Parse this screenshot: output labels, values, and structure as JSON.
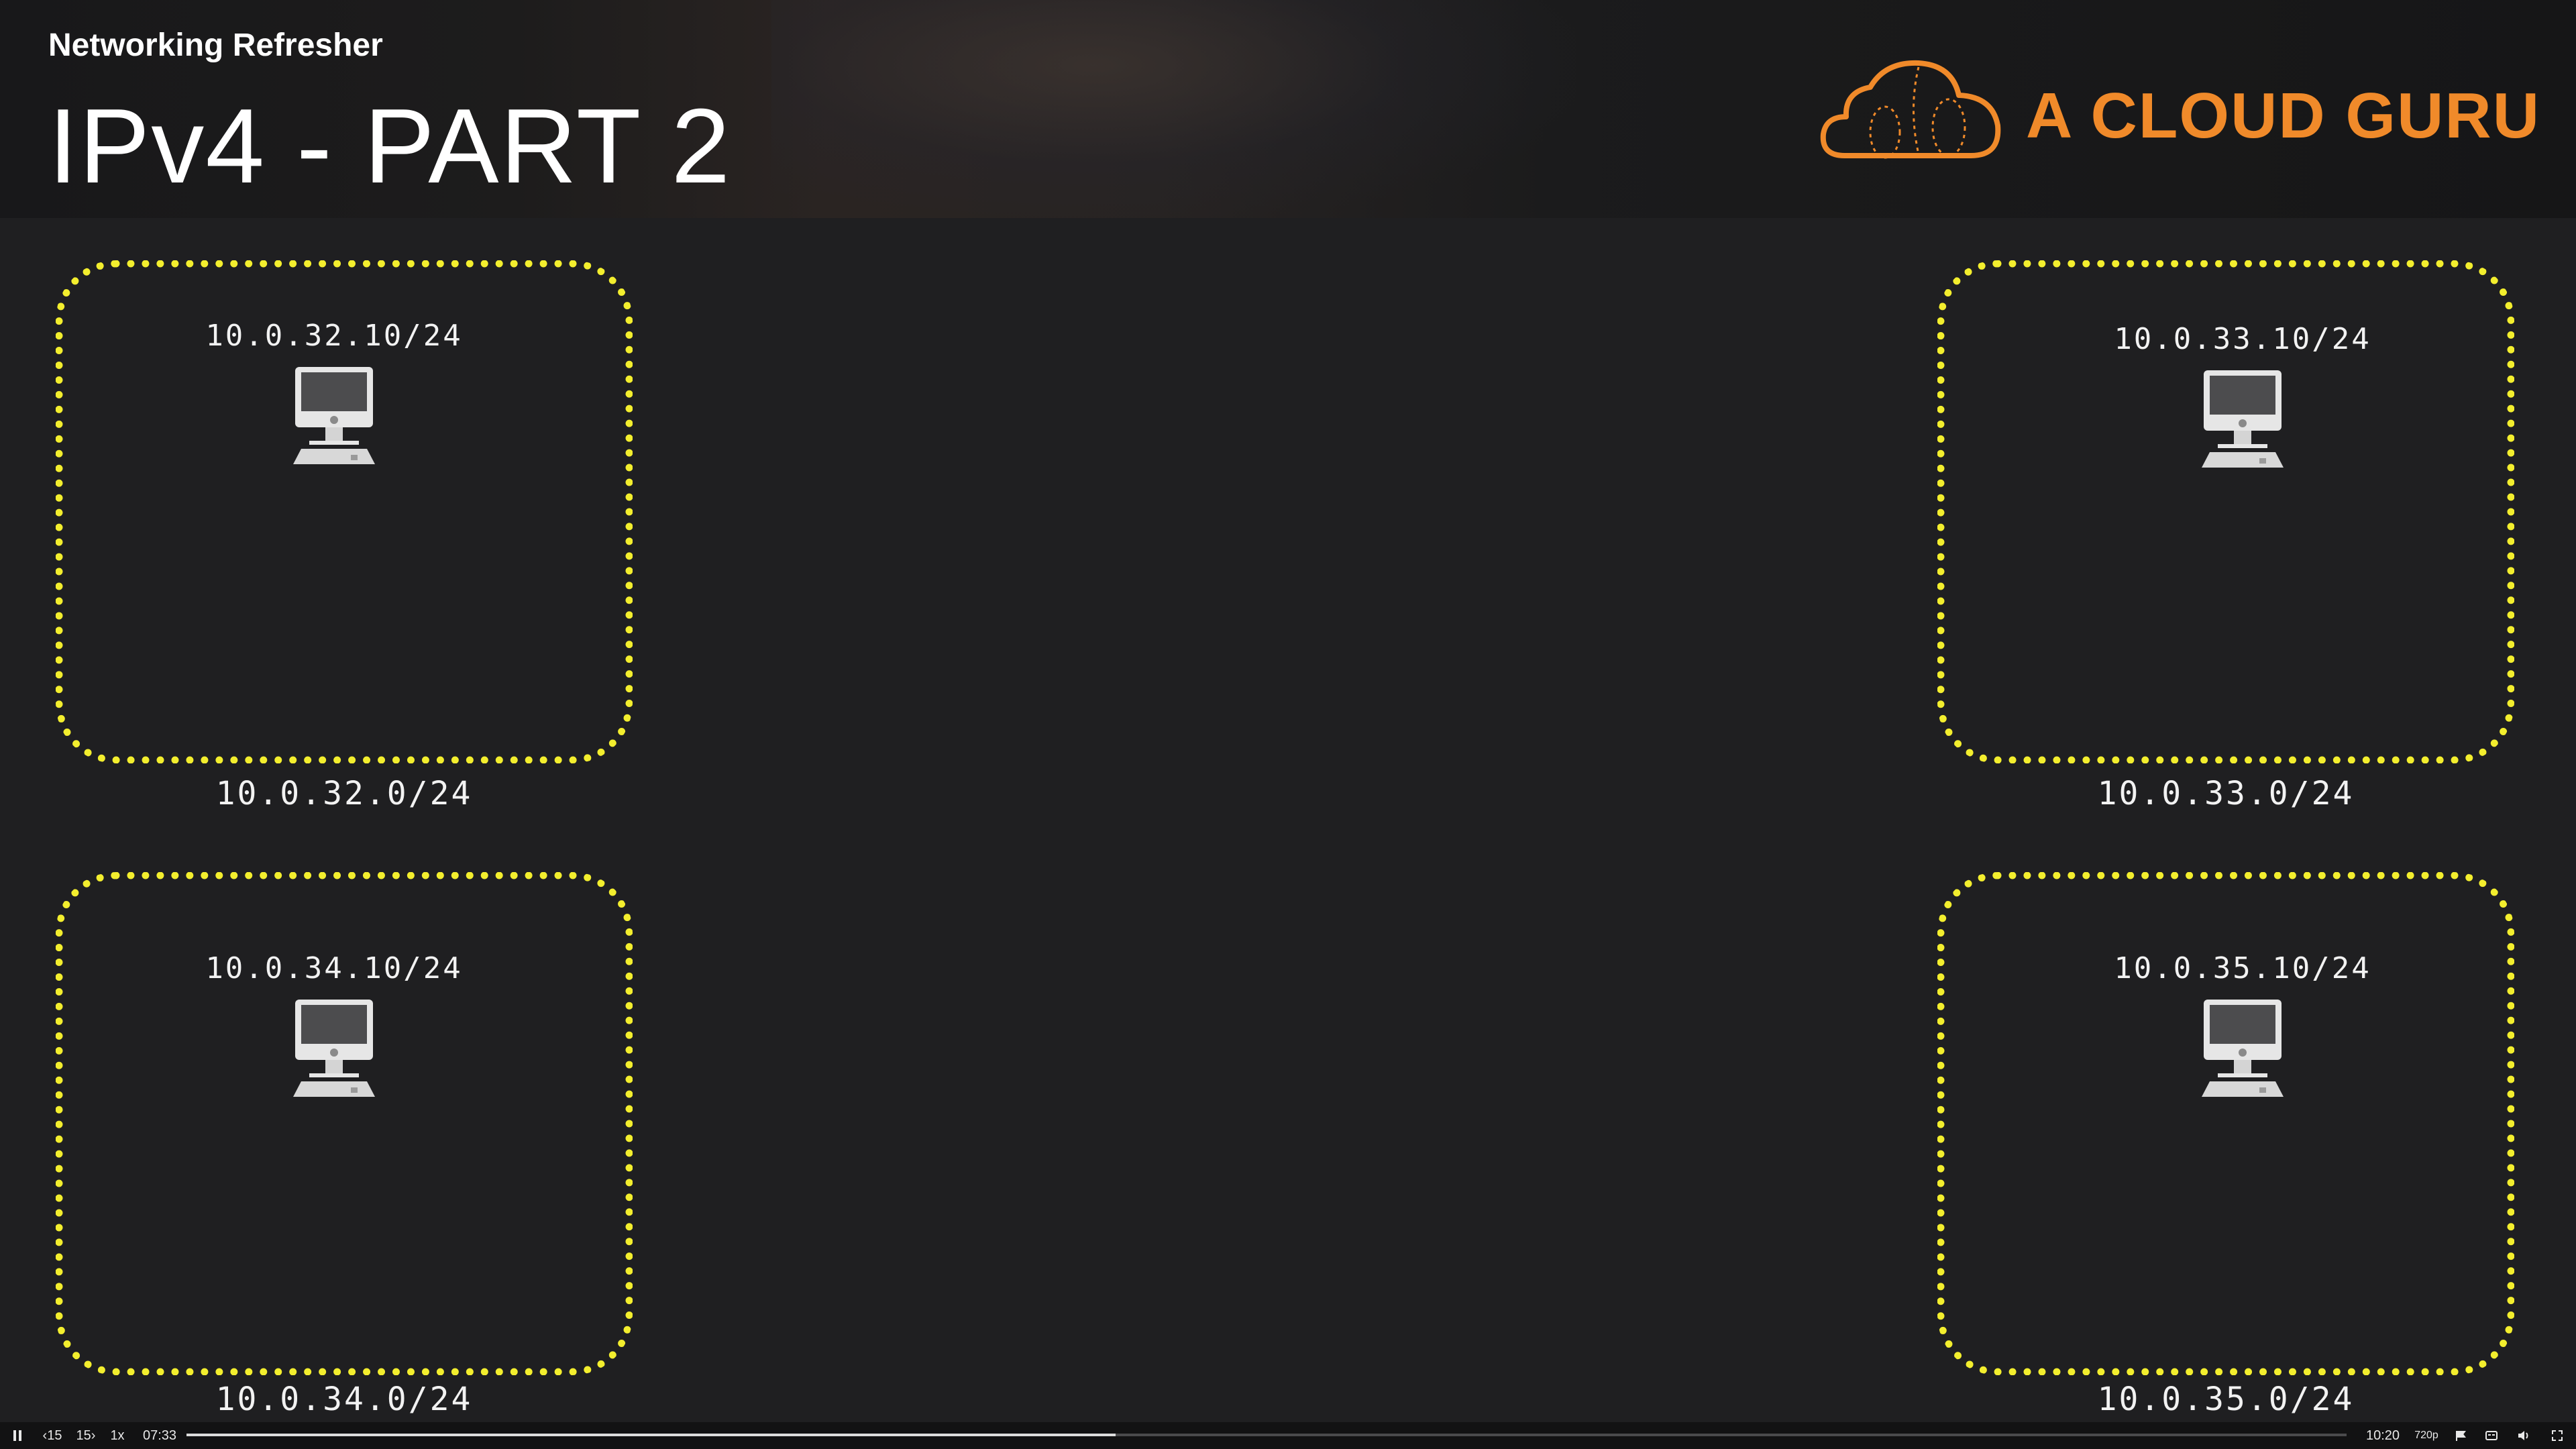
{
  "header": {
    "course": "Networking Refresher",
    "title": "IPv4 - PART 2",
    "logo_text": "A CLOUD GURU",
    "logo_icon": "cloud-logo-icon",
    "accent_color": "#f08a2a"
  },
  "subnets": [
    {
      "host_ip": "10.0.32.10/24",
      "network": "10.0.32.0/24"
    },
    {
      "host_ip": "10.0.33.10/24",
      "network": "10.0.33.0/24"
    },
    {
      "host_ip": "10.0.34.10/24",
      "network": "10.0.34.0/24"
    },
    {
      "host_ip": "10.0.35.10/24",
      "network": "10.0.35.0/24"
    }
  ],
  "subnet_border_color": "#f3ee2e",
  "player": {
    "pause_icon": "pause-icon",
    "rewind_label": "15",
    "forward_label": "15",
    "speed": "1x",
    "current_time": "07:33",
    "duration": "10:20",
    "quality": "720p",
    "progress": 0.43
  }
}
